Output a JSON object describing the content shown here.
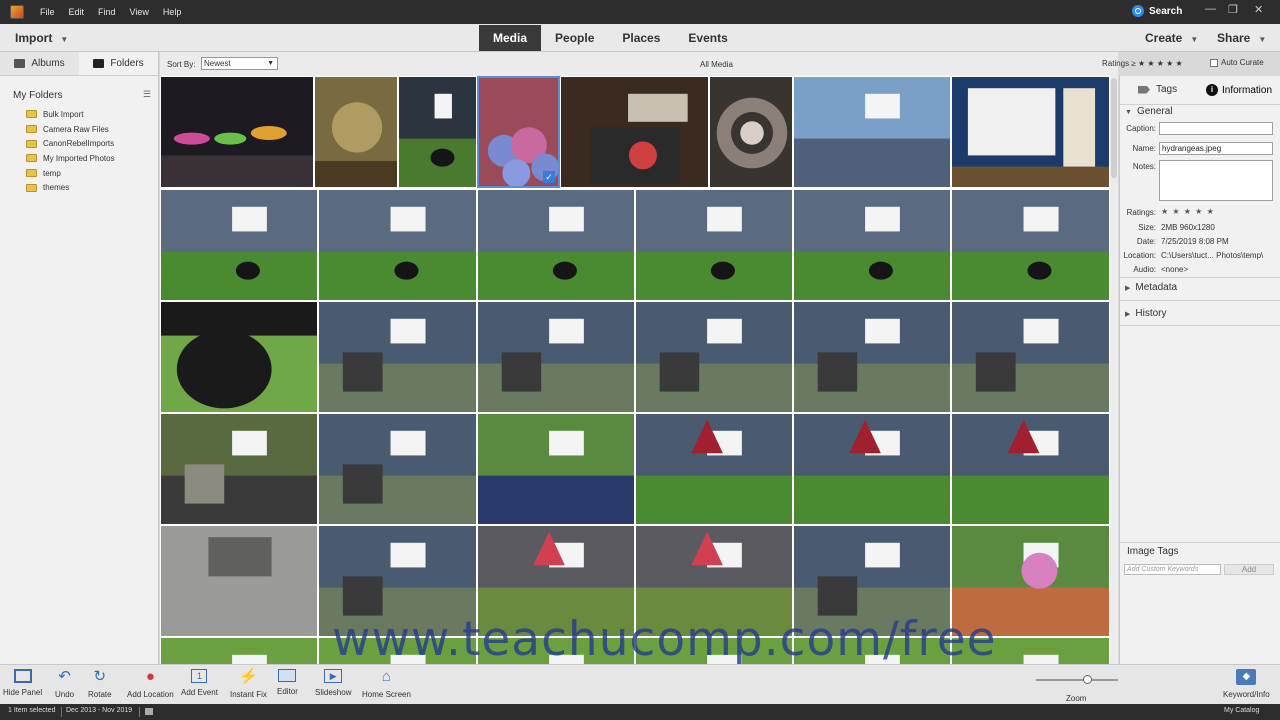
{
  "menubar": {
    "items": [
      "File",
      "Edit",
      "Find",
      "View",
      "Help"
    ],
    "search_label": "Search",
    "window_controls": [
      "—",
      "❐",
      "✕"
    ]
  },
  "topbar": {
    "import_label": "Import",
    "modes": [
      "Media",
      "People",
      "Places",
      "Events"
    ],
    "active_mode": "Media",
    "create_label": "Create",
    "share_label": "Share"
  },
  "left_panel": {
    "tabs": [
      "Albums",
      "Folders"
    ],
    "active_tab": "Folders",
    "my_folders_label": "My Folders",
    "folders": [
      "Bulk Import",
      "Camera Raw Files",
      "CanonRebelImports",
      "My Imported Photos",
      "temp",
      "themes"
    ]
  },
  "sortbar": {
    "sort_label": "Sort By:",
    "sort_value": "Newest",
    "view_title": "All Media",
    "ratings_label": "Ratings ≥ ★ ★ ★ ★ ★",
    "auto_curate_label": "Auto Curate"
  },
  "info_panel": {
    "tabs": [
      "Tags",
      "Information"
    ],
    "active_tab": "Information",
    "general_label": "General",
    "caption_label": "Caption:",
    "caption_value": "",
    "name_label": "Name:",
    "name_value": "hydrangeas.jpeg",
    "notes_label": "Notes:",
    "notes_value": "",
    "ratings_label": "Ratings:",
    "ratings_stars": "★ ★ ★ ★ ★",
    "size_label": "Size:",
    "size_value": "2MB  960x1280",
    "date_label": "Date:",
    "date_value": "7/25/2019 8:08 PM",
    "location_label": "Location:",
    "location_value": "C:\\Users\\tuct...  Photos\\temp\\",
    "audio_label": "Audio:",
    "audio_value": "<none>",
    "metadata_label": "Metadata",
    "history_label": "History",
    "image_tags_label": "Image Tags",
    "keyword_placeholder": "Add Custom Keywords",
    "add_label": "Add"
  },
  "toolbar": {
    "hide_panel": "Hide Panel",
    "undo": "Undo",
    "rotate": "Rotate",
    "add_location": "Add Location",
    "add_event": "Add Event",
    "instant_fix": "Instant Fix",
    "editor": "Editor",
    "slideshow": "Slideshow",
    "home_screen": "Home Screen",
    "zoom": "Zoom",
    "keyword_info": "Keyword/Info"
  },
  "statusbar": {
    "selection": "1 Item selected",
    "date_range": "Dec 2013 - Nov 2019",
    "catalog": "My Catalog"
  },
  "grid": {
    "selected_index": 3,
    "thumbs": [
      {
        "kind": "night-lights",
        "colors": [
          "#1e1a22",
          "#3a3038",
          "#c83a6a"
        ]
      },
      {
        "kind": "glass",
        "colors": [
          "#7a6a40",
          "#c8b070",
          "#4a3a20"
        ]
      },
      {
        "kind": "dog-grass",
        "colors": [
          "#2c3440",
          "#4a7a30",
          "#6aa040"
        ]
      },
      {
        "kind": "hydrangea",
        "colors": [
          "#9b4a5a",
          "#7a8ad0",
          "#c86aa0"
        ]
      },
      {
        "kind": "pillow",
        "colors": [
          "#3a2a20",
          "#c8c0b0",
          "#d04040"
        ]
      },
      {
        "kind": "mandala",
        "colors": [
          "#3a3430",
          "#8a8078",
          "#d8d0c8"
        ]
      },
      {
        "kind": "shed",
        "colors": [
          "#7aa0c8",
          "#50607a",
          "#4a8a30"
        ]
      },
      {
        "kind": "bedroom",
        "colors": [
          "#1c3a6a",
          "#f0f0f0",
          "#6a5030"
        ]
      },
      {
        "kind": "shed-dog",
        "colors": [
          "#5a6a80",
          "#4a8a30",
          "#70a848"
        ]
      },
      {
        "kind": "shed-dog",
        "colors": [
          "#5a6a80",
          "#4a8a30",
          "#70a848"
        ]
      },
      {
        "kind": "shed-dog",
        "colors": [
          "#5a6a80",
          "#4a8a30",
          "#70a848"
        ]
      },
      {
        "kind": "shed-dog",
        "colors": [
          "#5a6a80",
          "#4a8a30",
          "#70a848"
        ]
      },
      {
        "kind": "shed-dog",
        "colors": [
          "#5a6a80",
          "#4a8a30",
          "#70a848"
        ]
      },
      {
        "kind": "shed-dog",
        "colors": [
          "#5a6a80",
          "#4a8a30",
          "#70a848"
        ]
      },
      {
        "kind": "dog-close",
        "colors": [
          "#1a1a1a",
          "#4a8a30",
          "#70a848"
        ]
      },
      {
        "kind": "patio",
        "colors": [
          "#4a5a70",
          "#6a7a60",
          "#3a3a3a"
        ]
      },
      {
        "kind": "patio",
        "colors": [
          "#4a5a70",
          "#6a7a60",
          "#3a3a3a"
        ]
      },
      {
        "kind": "patio",
        "colors": [
          "#4a5a70",
          "#6a7a60",
          "#3a3a3a"
        ]
      },
      {
        "kind": "patio",
        "colors": [
          "#4a5a70",
          "#6a7a60",
          "#3a3a3a"
        ]
      },
      {
        "kind": "patio",
        "colors": [
          "#4a5a70",
          "#6a7a60",
          "#3a3a3a"
        ]
      },
      {
        "kind": "yard-grill",
        "colors": [
          "#5a6a40",
          "#3a3a3a",
          "#8a8a80"
        ]
      },
      {
        "kind": "patio",
        "colors": [
          "#4a5a70",
          "#6a7a60",
          "#3a3a3a"
        ]
      },
      {
        "kind": "garden",
        "colors": [
          "#5a8a40",
          "#2a3a6a",
          "#8a8a70"
        ]
      },
      {
        "kind": "umbrella",
        "colors": [
          "#4a5a70",
          "#4a8a30",
          "#a02030"
        ]
      },
      {
        "kind": "umbrella",
        "colors": [
          "#4a5a70",
          "#4a8a30",
          "#a02030"
        ]
      },
      {
        "kind": "umbrella",
        "colors": [
          "#4a5a70",
          "#4a8a30",
          "#a02030"
        ]
      },
      {
        "kind": "pavers",
        "colors": [
          "#9a9a98",
          "#3a3a38",
          "#6a6a68"
        ]
      },
      {
        "kind": "patio",
        "colors": [
          "#4a5a70",
          "#6a7a60",
          "#3a3a3a"
        ]
      },
      {
        "kind": "umbrella",
        "colors": [
          "#5a5a60",
          "#6a8a40",
          "#d04050"
        ]
      },
      {
        "kind": "umbrella",
        "colors": [
          "#5a5a60",
          "#6a8a40",
          "#d04050"
        ]
      },
      {
        "kind": "patio",
        "colors": [
          "#4a5a70",
          "#6a7a60",
          "#3a3a3a"
        ]
      },
      {
        "kind": "planter",
        "colors": [
          "#5a8a40",
          "#c06a40",
          "#d880c0"
        ]
      },
      {
        "kind": "yard",
        "colors": [
          "#6aa040",
          "#f0e0a0",
          "#4a8a30"
        ]
      },
      {
        "kind": "yard",
        "colors": [
          "#6aa040",
          "#f0e0a0",
          "#4a8a30"
        ]
      },
      {
        "kind": "yard",
        "colors": [
          "#6aa040",
          "#f0e0a0",
          "#4a8a30"
        ]
      },
      {
        "kind": "yard",
        "colors": [
          "#6aa040",
          "#f0e0a0",
          "#4a8a30"
        ]
      },
      {
        "kind": "yard",
        "colors": [
          "#6aa040",
          "#f0e0a0",
          "#4a8a30"
        ]
      },
      {
        "kind": "yard",
        "colors": [
          "#6aa040",
          "#f0e0a0",
          "#4a8a30"
        ]
      }
    ]
  },
  "watermark": "www.teachucomp.com/free"
}
